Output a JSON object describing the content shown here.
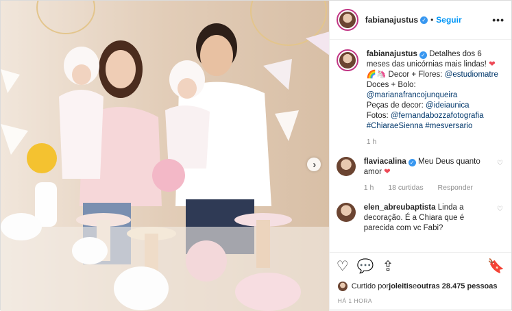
{
  "header": {
    "username": "fabianajustus",
    "separator": "•",
    "follow_label": "Seguir",
    "more_label": "•••"
  },
  "media": {
    "next_label": "›"
  },
  "caption": {
    "username": "fabianajustus",
    "text_1": "Detalhes dos 6 meses das unicórnias mais lindas!",
    "heart": "❤",
    "line_2_prefix": "🌈🦄 Decor + Flores: ",
    "mention_decor": "@estudiomatre",
    "line_3": "Doces + Bolo:",
    "mention_doces": "@marianafrancojunqueira",
    "line_5_prefix": "Peças de decor: ",
    "mention_pecas": "@ideiaunica",
    "line_6_prefix": "Fotos: ",
    "mention_fotos": "@fernandabozzafotografia",
    "hashtags": "#ChiaraeSienna #mesversario",
    "time": "1 h"
  },
  "comments": [
    {
      "username": "flaviacalina",
      "text": "Meu Deus quanto amor",
      "emoji": "❤",
      "time": "1 h",
      "likes": "18 curtidas",
      "reply": "Responder"
    },
    {
      "username": "elen_abreubaptista",
      "text": "Linda a decoração. É a Chiara que é parecida com vc Fabi?"
    }
  ],
  "actions": {
    "like_icon": "heart-icon",
    "comment_icon": "comment-icon",
    "share_icon": "share-icon",
    "save_icon": "bookmark-icon"
  },
  "likes": {
    "prefix": "Curtido por ",
    "user": "joleitis",
    "middle": " e ",
    "others": "outras 28.475 pessoas"
  },
  "timestamp": "HÁ 1 HORA",
  "colors": {
    "link": "#00376b",
    "follow": "#0095f6",
    "verified": "#3897f0",
    "heart": "#ed4956"
  }
}
